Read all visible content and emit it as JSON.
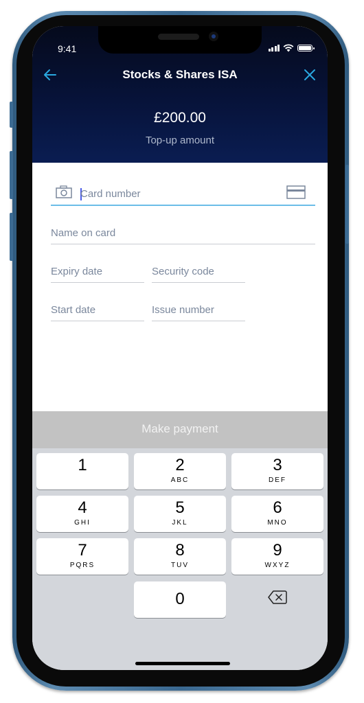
{
  "status_bar": {
    "time": "9:41"
  },
  "header": {
    "title": "Stocks & Shares ISA",
    "back_icon": "arrow-left-icon",
    "close_icon": "close-icon",
    "amount": "£200.00",
    "amount_label": "Top-up amount",
    "accent_color": "#29a9e1"
  },
  "form": {
    "card_number": {
      "placeholder": "Card number",
      "value": ""
    },
    "name_on_card": {
      "placeholder": "Name on card",
      "value": ""
    },
    "expiry_date": {
      "placeholder": "Expiry date",
      "value": ""
    },
    "security_code": {
      "placeholder": "Security code",
      "value": ""
    },
    "start_date": {
      "placeholder": "Start date",
      "value": ""
    },
    "issue_number": {
      "placeholder": "Issue number",
      "value": ""
    }
  },
  "actions": {
    "make_payment": "Make payment"
  },
  "keypad": {
    "keys": [
      {
        "num": "1",
        "letters": ""
      },
      {
        "num": "2",
        "letters": "ABC"
      },
      {
        "num": "3",
        "letters": "DEF"
      },
      {
        "num": "4",
        "letters": "GHI"
      },
      {
        "num": "5",
        "letters": "JKL"
      },
      {
        "num": "6",
        "letters": "MNO"
      },
      {
        "num": "7",
        "letters": "PQRS"
      },
      {
        "num": "8",
        "letters": "TUV"
      },
      {
        "num": "9",
        "letters": "WXYZ"
      },
      {
        "num": "0",
        "letters": ""
      }
    ]
  }
}
